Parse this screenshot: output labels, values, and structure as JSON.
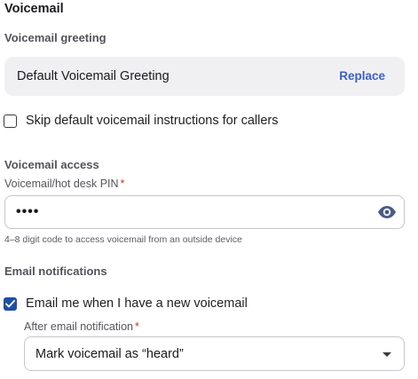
{
  "page": {
    "title": "Voicemail"
  },
  "greeting": {
    "section_label": "Voicemail greeting",
    "name": "Default Voicemail Greeting",
    "replace_label": "Replace"
  },
  "skip_instructions": {
    "label": "Skip default voicemail instructions for callers",
    "checked": false
  },
  "access": {
    "section_label": "Voicemail access",
    "pin_label": "Voicemail/hot desk PIN",
    "required_mark": "*",
    "pin_value": "••••",
    "hint": "4–8 digit code to access voicemail from an outside device",
    "visibility_icon": "eye-icon"
  },
  "email": {
    "section_label": "Email notifications",
    "notify_label": "Email me when I have a new voicemail",
    "notify_checked": true,
    "after_label": "After email notification",
    "required_mark": "*",
    "after_value": "Mark voicemail as “heard”",
    "dropdown_icon": "chevron-down-icon"
  },
  "colors": {
    "accent": "#1f4fa5",
    "link": "#3b5fc4",
    "required": "#c8322a"
  }
}
